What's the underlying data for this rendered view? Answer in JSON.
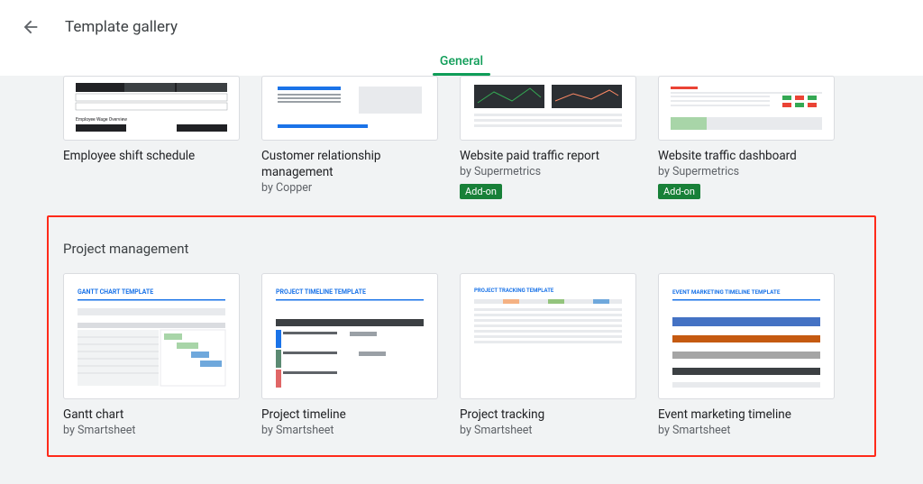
{
  "header": {
    "title": "Template gallery"
  },
  "tabs": {
    "active": "General"
  },
  "row1": [
    {
      "title": "Employee shift schedule",
      "author": ""
    },
    {
      "title": "Customer relationship management",
      "author": "by Copper"
    },
    {
      "title": "Website paid traffic report",
      "author": "by Supermetrics",
      "badge": "Add-on"
    },
    {
      "title": "Website traffic dashboard",
      "author": "by Supermetrics",
      "badge": "Add-on"
    }
  ],
  "section2": {
    "title": "Project management"
  },
  "row2": [
    {
      "title": "Gantt chart",
      "author": "by Smartsheet"
    },
    {
      "title": "Project timeline",
      "author": "by Smartsheet"
    },
    {
      "title": "Project tracking",
      "author": "by Smartsheet"
    },
    {
      "title": "Event marketing timeline",
      "author": "by Smartsheet"
    }
  ]
}
